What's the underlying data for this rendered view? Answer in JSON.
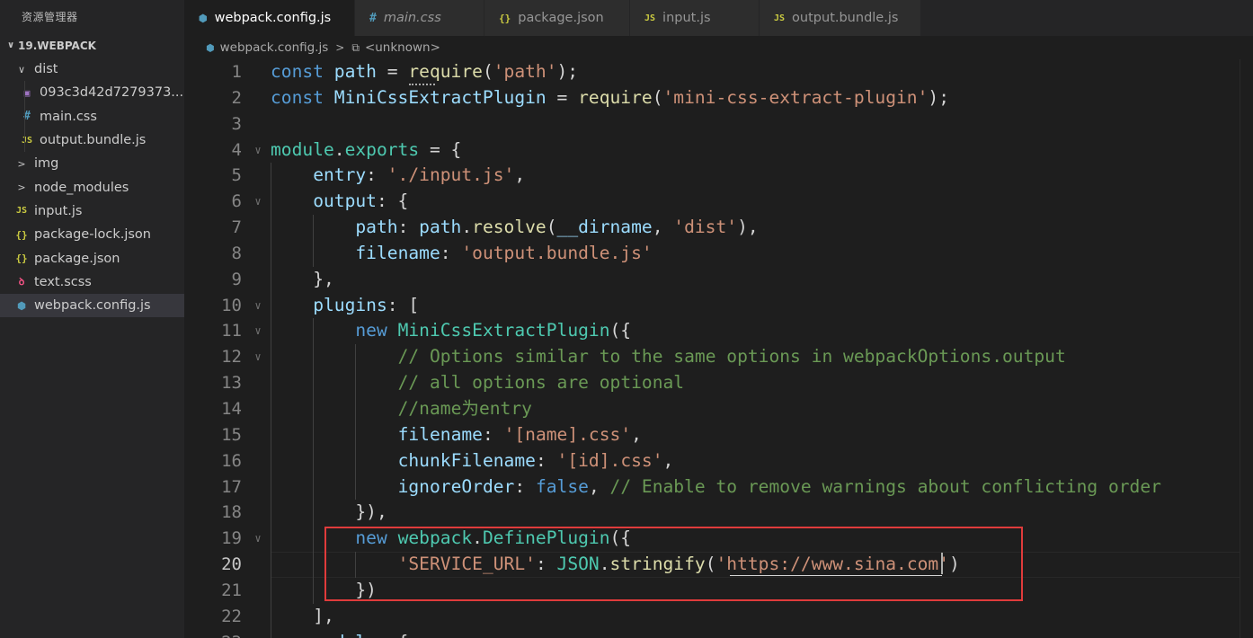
{
  "sidebar": {
    "title": "资源管理器",
    "project": "19.WEBPACK",
    "items": [
      {
        "name": "dist",
        "type": "folder",
        "expanded": true,
        "depth": 0,
        "icon": "chevron-down-icon"
      },
      {
        "name": "093c3d42d7279373...",
        "type": "image",
        "depth": 1,
        "icon": "image-file-icon"
      },
      {
        "name": "main.css",
        "type": "css",
        "depth": 1,
        "icon": "css-file-icon"
      },
      {
        "name": "output.bundle.js",
        "type": "js",
        "depth": 1,
        "icon": "js-file-icon"
      },
      {
        "name": "img",
        "type": "folder",
        "expanded": false,
        "depth": 0,
        "icon": "chevron-right-icon"
      },
      {
        "name": "node_modules",
        "type": "folder",
        "expanded": false,
        "depth": 0,
        "icon": "chevron-right-icon"
      },
      {
        "name": "input.js",
        "type": "js",
        "depth": 0,
        "icon": "js-file-icon"
      },
      {
        "name": "package-lock.json",
        "type": "json",
        "depth": 0,
        "icon": "json-file-icon"
      },
      {
        "name": "package.json",
        "type": "json",
        "depth": 0,
        "icon": "json-file-icon"
      },
      {
        "name": "text.scss",
        "type": "scss",
        "depth": 0,
        "icon": "scss-file-icon"
      },
      {
        "name": "webpack.config.js",
        "type": "config",
        "depth": 0,
        "icon": "webpack-file-icon",
        "selected": true
      }
    ]
  },
  "tabs": [
    {
      "label": "webpack.config.js",
      "icon": "webpack-file-icon",
      "active": true,
      "modified": true
    },
    {
      "label": "main.css",
      "icon": "css-file-icon",
      "italic": true
    },
    {
      "label": "package.json",
      "icon": "json-file-icon"
    },
    {
      "label": "input.js",
      "icon": "js-file-icon"
    },
    {
      "label": "output.bundle.js",
      "icon": "js-file-icon"
    }
  ],
  "breadcrumb": {
    "file": "webpack.config.js",
    "symbol": "<unknown>"
  },
  "icons": {
    "js": "JS",
    "css": "#",
    "json": "{}",
    "chevron_down": "∨",
    "chevron_right": ">"
  },
  "code": {
    "current_line": 20,
    "lines": [
      {
        "n": "1",
        "fold": "",
        "indent": 0,
        "tokens": [
          [
            "k",
            "const "
          ],
          [
            "v",
            "path"
          ],
          [
            "o",
            " = "
          ],
          [
            "f",
            "require"
          ],
          [
            "p",
            "("
          ],
          [
            "s",
            "'path'"
          ],
          [
            "p",
            ");"
          ]
        ]
      },
      {
        "n": "2",
        "fold": "",
        "indent": 0,
        "tokens": [
          [
            "k",
            "const "
          ],
          [
            "v",
            "MiniCssExtractPlugin"
          ],
          [
            "o",
            " = "
          ],
          [
            "f",
            "require"
          ],
          [
            "p",
            "("
          ],
          [
            "s",
            "'mini-css-extract-plugin'"
          ],
          [
            "p",
            ");"
          ]
        ]
      },
      {
        "n": "3",
        "fold": "",
        "indent": 0,
        "tokens": []
      },
      {
        "n": "4",
        "fold": "v",
        "indent": 0,
        "tokens": [
          [
            "cl",
            "module"
          ],
          [
            "p",
            "."
          ],
          [
            "cl",
            "exports"
          ],
          [
            "o",
            " = "
          ],
          [
            "p",
            "{"
          ]
        ]
      },
      {
        "n": "5",
        "fold": "",
        "indent": 1,
        "tokens": [
          [
            "v",
            "entry"
          ],
          [
            "p",
            ": "
          ],
          [
            "s",
            "'./input.js'"
          ],
          [
            "p",
            ","
          ]
        ]
      },
      {
        "n": "6",
        "fold": "v",
        "indent": 1,
        "tokens": [
          [
            "v",
            "output"
          ],
          [
            "p",
            ": {"
          ]
        ]
      },
      {
        "n": "7",
        "fold": "",
        "indent": 2,
        "tokens": [
          [
            "v",
            "path"
          ],
          [
            "p",
            ": "
          ],
          [
            "v",
            "path"
          ],
          [
            "p",
            "."
          ],
          [
            "f",
            "resolve"
          ],
          [
            "p",
            "("
          ],
          [
            "v",
            "__dirname"
          ],
          [
            "p",
            ", "
          ],
          [
            "s",
            "'dist'"
          ],
          [
            "p",
            "),"
          ]
        ]
      },
      {
        "n": "8",
        "fold": "",
        "indent": 2,
        "tokens": [
          [
            "v",
            "filename"
          ],
          [
            "p",
            ": "
          ],
          [
            "s",
            "'output.bundle.js'"
          ]
        ]
      },
      {
        "n": "9",
        "fold": "",
        "indent": 1,
        "tokens": [
          [
            "p",
            "},"
          ]
        ]
      },
      {
        "n": "10",
        "fold": "v",
        "indent": 1,
        "tokens": [
          [
            "v",
            "plugins"
          ],
          [
            "p",
            ": ["
          ]
        ]
      },
      {
        "n": "11",
        "fold": "v",
        "indent": 2,
        "tokens": [
          [
            "k",
            "new "
          ],
          [
            "cl",
            "MiniCssExtractPlugin"
          ],
          [
            "p",
            "({"
          ]
        ]
      },
      {
        "n": "12",
        "fold": "v",
        "indent": 3,
        "tokens": [
          [
            "c",
            "// Options similar to the same options in webpackOptions.output"
          ]
        ]
      },
      {
        "n": "13",
        "fold": "",
        "indent": 3,
        "tokens": [
          [
            "c",
            "// all options are optional"
          ]
        ]
      },
      {
        "n": "14",
        "fold": "",
        "indent": 3,
        "tokens": [
          [
            "c",
            "//name为entry"
          ]
        ]
      },
      {
        "n": "15",
        "fold": "",
        "indent": 3,
        "tokens": [
          [
            "v",
            "filename"
          ],
          [
            "p",
            ": "
          ],
          [
            "s",
            "'[name].css'"
          ],
          [
            "p",
            ","
          ]
        ]
      },
      {
        "n": "16",
        "fold": "",
        "indent": 3,
        "tokens": [
          [
            "v",
            "chunkFilename"
          ],
          [
            "p",
            ": "
          ],
          [
            "s",
            "'[id].css'"
          ],
          [
            "p",
            ","
          ]
        ]
      },
      {
        "n": "17",
        "fold": "",
        "indent": 3,
        "tokens": [
          [
            "v",
            "ignoreOrder"
          ],
          [
            "p",
            ": "
          ],
          [
            "k",
            "false"
          ],
          [
            "p",
            ", "
          ],
          [
            "c",
            "// Enable to remove warnings about conflicting order"
          ]
        ]
      },
      {
        "n": "18",
        "fold": "",
        "indent": 2,
        "tokens": [
          [
            "p",
            "}),"
          ]
        ]
      },
      {
        "n": "19",
        "fold": "v",
        "indent": 2,
        "tokens": [
          [
            "k",
            "new "
          ],
          [
            "cl",
            "webpack"
          ],
          [
            "p",
            "."
          ],
          [
            "cl",
            "DefinePlugin"
          ],
          [
            "p",
            "({"
          ]
        ]
      },
      {
        "n": "20",
        "fold": "",
        "indent": 3,
        "tokens": [
          [
            "s",
            "'SERVICE_URL'"
          ],
          [
            "p",
            ": "
          ],
          [
            "cl",
            "JSON"
          ],
          [
            "p",
            "."
          ],
          [
            "f",
            "stringify"
          ],
          [
            "p",
            "("
          ],
          [
            "s",
            "'https://www.sina.com'"
          ],
          [
            "p",
            ")"
          ]
        ]
      },
      {
        "n": "21",
        "fold": "",
        "indent": 2,
        "tokens": [
          [
            "p",
            "})"
          ]
        ]
      },
      {
        "n": "22",
        "fold": "",
        "indent": 1,
        "tokens": [
          [
            "p",
            "],"
          ]
        ]
      },
      {
        "n": "23",
        "fold": "v",
        "indent": 1,
        "tokens": [
          [
            "v",
            "module"
          ],
          [
            "p",
            ": {"
          ]
        ]
      }
    ]
  },
  "colors": {
    "highlight_box": "#e03b3b",
    "editor_bg": "#1e1e1e",
    "sidebar_bg": "#252526"
  }
}
